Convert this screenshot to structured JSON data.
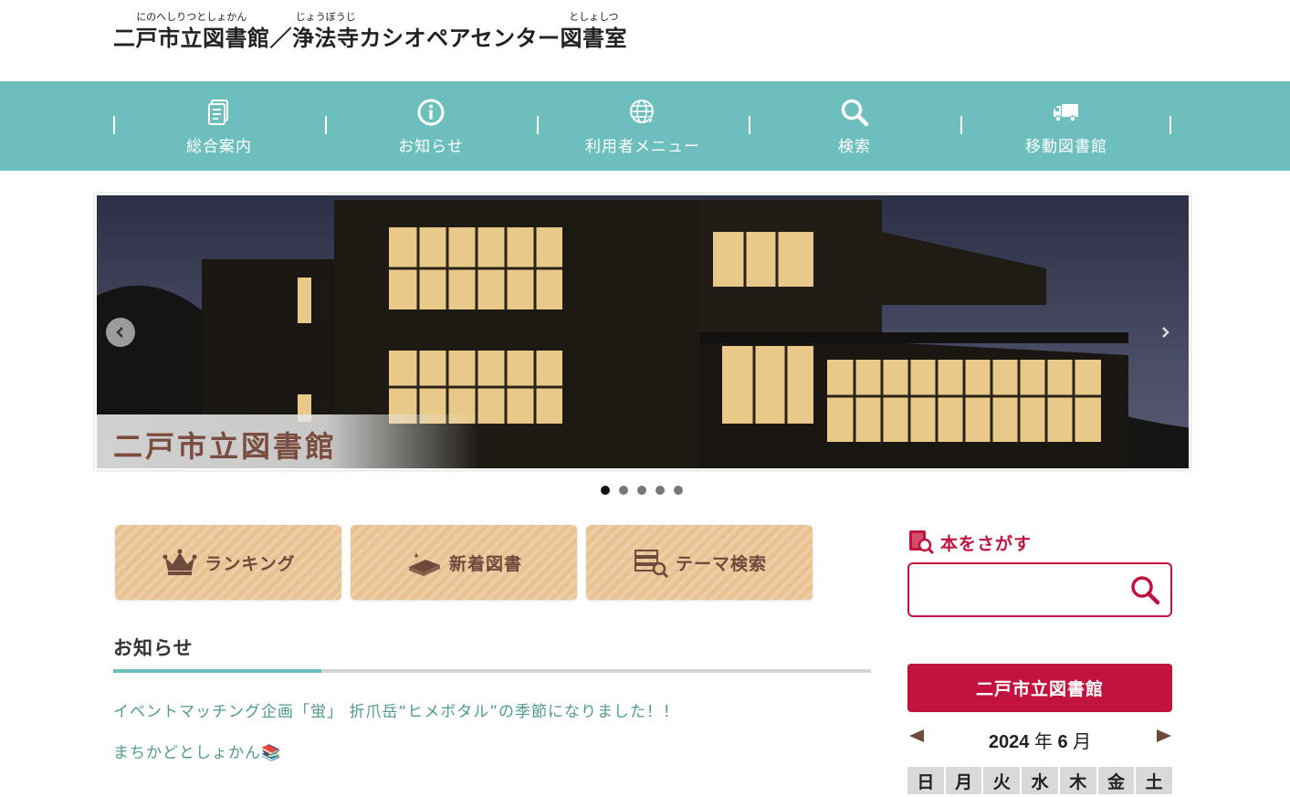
{
  "header": {
    "title_segments": [
      {
        "text": "二戸市立図書館",
        "ruby": "にのへしりつとしょかん"
      },
      {
        "text": "／",
        "ruby": ""
      },
      {
        "text": "浄法寺",
        "ruby": "じょうぼうじ"
      },
      {
        "text": "カシオペアセンター",
        "ruby": ""
      },
      {
        "text": "図書室",
        "ruby": "としょしつ"
      }
    ]
  },
  "nav": {
    "items": [
      {
        "label": "総合案内",
        "icon": "document-icon"
      },
      {
        "label": "お知らせ",
        "icon": "info-icon"
      },
      {
        "label": "利用者メニュー",
        "icon": "globe-icon"
      },
      {
        "label": "検索",
        "icon": "search-icon"
      },
      {
        "label": "移動図書館",
        "icon": "truck-icon"
      }
    ]
  },
  "slider": {
    "caption": "二戸市立図書館",
    "dots_count": 5,
    "active_dot": 1
  },
  "quick_buttons": [
    {
      "label": "ランキング",
      "icon": "crown-icon"
    },
    {
      "label": "新着図書",
      "icon": "new-book-icon"
    },
    {
      "label": "テーマ検索",
      "icon": "book-search-icon"
    }
  ],
  "news": {
    "heading": "お知らせ",
    "items": [
      {
        "text": "イベントマッチング企画「蛍」 折爪岳“ヒメボタル”の季節になりました！！"
      },
      {
        "text": "まちかどとしょかん📚"
      }
    ]
  },
  "sidebar": {
    "search_title": "本をさがす",
    "search_placeholder": "",
    "library_button": "二戸市立図書館",
    "calendar": {
      "year": "2024",
      "year_unit": "年",
      "month": "6",
      "month_unit": "月",
      "weekdays": [
        "日",
        "月",
        "火",
        "水",
        "木",
        "金",
        "土"
      ]
    }
  },
  "colors": {
    "nav_bg": "#6cbfbd",
    "accent_red": "#c2133e",
    "quick_button_bg": "#e9c292",
    "link_green": "#4f9a8f"
  }
}
